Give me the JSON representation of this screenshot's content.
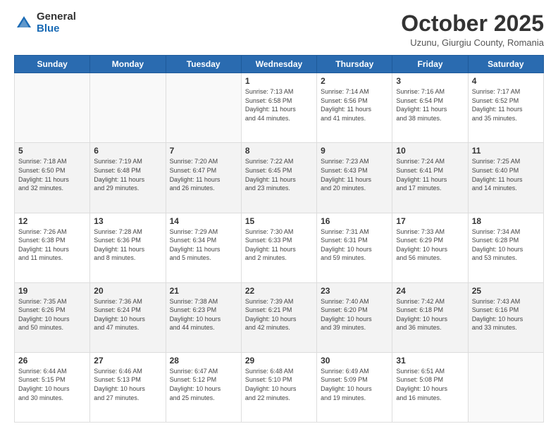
{
  "header": {
    "logo_general": "General",
    "logo_blue": "Blue",
    "month_title": "October 2025",
    "subtitle": "Uzunu, Giurgiu County, Romania"
  },
  "days_of_week": [
    "Sunday",
    "Monday",
    "Tuesday",
    "Wednesday",
    "Thursday",
    "Friday",
    "Saturday"
  ],
  "weeks": [
    {
      "shade": "white",
      "days": [
        {
          "number": "",
          "info": ""
        },
        {
          "number": "",
          "info": ""
        },
        {
          "number": "",
          "info": ""
        },
        {
          "number": "1",
          "info": "Sunrise: 7:13 AM\nSunset: 6:58 PM\nDaylight: 11 hours\nand 44 minutes."
        },
        {
          "number": "2",
          "info": "Sunrise: 7:14 AM\nSunset: 6:56 PM\nDaylight: 11 hours\nand 41 minutes."
        },
        {
          "number": "3",
          "info": "Sunrise: 7:16 AM\nSunset: 6:54 PM\nDaylight: 11 hours\nand 38 minutes."
        },
        {
          "number": "4",
          "info": "Sunrise: 7:17 AM\nSunset: 6:52 PM\nDaylight: 11 hours\nand 35 minutes."
        }
      ]
    },
    {
      "shade": "shaded",
      "days": [
        {
          "number": "5",
          "info": "Sunrise: 7:18 AM\nSunset: 6:50 PM\nDaylight: 11 hours\nand 32 minutes."
        },
        {
          "number": "6",
          "info": "Sunrise: 7:19 AM\nSunset: 6:48 PM\nDaylight: 11 hours\nand 29 minutes."
        },
        {
          "number": "7",
          "info": "Sunrise: 7:20 AM\nSunset: 6:47 PM\nDaylight: 11 hours\nand 26 minutes."
        },
        {
          "number": "8",
          "info": "Sunrise: 7:22 AM\nSunset: 6:45 PM\nDaylight: 11 hours\nand 23 minutes."
        },
        {
          "number": "9",
          "info": "Sunrise: 7:23 AM\nSunset: 6:43 PM\nDaylight: 11 hours\nand 20 minutes."
        },
        {
          "number": "10",
          "info": "Sunrise: 7:24 AM\nSunset: 6:41 PM\nDaylight: 11 hours\nand 17 minutes."
        },
        {
          "number": "11",
          "info": "Sunrise: 7:25 AM\nSunset: 6:40 PM\nDaylight: 11 hours\nand 14 minutes."
        }
      ]
    },
    {
      "shade": "white",
      "days": [
        {
          "number": "12",
          "info": "Sunrise: 7:26 AM\nSunset: 6:38 PM\nDaylight: 11 hours\nand 11 minutes."
        },
        {
          "number": "13",
          "info": "Sunrise: 7:28 AM\nSunset: 6:36 PM\nDaylight: 11 hours\nand 8 minutes."
        },
        {
          "number": "14",
          "info": "Sunrise: 7:29 AM\nSunset: 6:34 PM\nDaylight: 11 hours\nand 5 minutes."
        },
        {
          "number": "15",
          "info": "Sunrise: 7:30 AM\nSunset: 6:33 PM\nDaylight: 11 hours\nand 2 minutes."
        },
        {
          "number": "16",
          "info": "Sunrise: 7:31 AM\nSunset: 6:31 PM\nDaylight: 10 hours\nand 59 minutes."
        },
        {
          "number": "17",
          "info": "Sunrise: 7:33 AM\nSunset: 6:29 PM\nDaylight: 10 hours\nand 56 minutes."
        },
        {
          "number": "18",
          "info": "Sunrise: 7:34 AM\nSunset: 6:28 PM\nDaylight: 10 hours\nand 53 minutes."
        }
      ]
    },
    {
      "shade": "shaded",
      "days": [
        {
          "number": "19",
          "info": "Sunrise: 7:35 AM\nSunset: 6:26 PM\nDaylight: 10 hours\nand 50 minutes."
        },
        {
          "number": "20",
          "info": "Sunrise: 7:36 AM\nSunset: 6:24 PM\nDaylight: 10 hours\nand 47 minutes."
        },
        {
          "number": "21",
          "info": "Sunrise: 7:38 AM\nSunset: 6:23 PM\nDaylight: 10 hours\nand 44 minutes."
        },
        {
          "number": "22",
          "info": "Sunrise: 7:39 AM\nSunset: 6:21 PM\nDaylight: 10 hours\nand 42 minutes."
        },
        {
          "number": "23",
          "info": "Sunrise: 7:40 AM\nSunset: 6:20 PM\nDaylight: 10 hours\nand 39 minutes."
        },
        {
          "number": "24",
          "info": "Sunrise: 7:42 AM\nSunset: 6:18 PM\nDaylight: 10 hours\nand 36 minutes."
        },
        {
          "number": "25",
          "info": "Sunrise: 7:43 AM\nSunset: 6:16 PM\nDaylight: 10 hours\nand 33 minutes."
        }
      ]
    },
    {
      "shade": "white",
      "days": [
        {
          "number": "26",
          "info": "Sunrise: 6:44 AM\nSunset: 5:15 PM\nDaylight: 10 hours\nand 30 minutes."
        },
        {
          "number": "27",
          "info": "Sunrise: 6:46 AM\nSunset: 5:13 PM\nDaylight: 10 hours\nand 27 minutes."
        },
        {
          "number": "28",
          "info": "Sunrise: 6:47 AM\nSunset: 5:12 PM\nDaylight: 10 hours\nand 25 minutes."
        },
        {
          "number": "29",
          "info": "Sunrise: 6:48 AM\nSunset: 5:10 PM\nDaylight: 10 hours\nand 22 minutes."
        },
        {
          "number": "30",
          "info": "Sunrise: 6:49 AM\nSunset: 5:09 PM\nDaylight: 10 hours\nand 19 minutes."
        },
        {
          "number": "31",
          "info": "Sunrise: 6:51 AM\nSunset: 5:08 PM\nDaylight: 10 hours\nand 16 minutes."
        },
        {
          "number": "",
          "info": ""
        }
      ]
    }
  ]
}
